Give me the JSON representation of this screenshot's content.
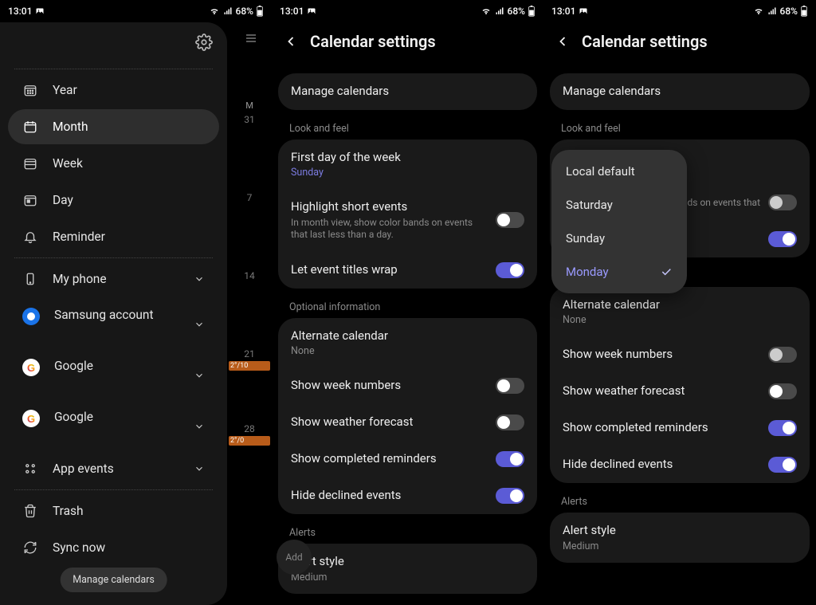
{
  "status": {
    "time": "13:01",
    "battery": "68%"
  },
  "drawer": {
    "items": [
      {
        "icon": "calendar-year-icon",
        "label": "Year"
      },
      {
        "icon": "calendar-month-icon",
        "label": "Month"
      },
      {
        "icon": "calendar-week-icon",
        "label": "Week"
      },
      {
        "icon": "calendar-day-icon",
        "label": "Day"
      },
      {
        "icon": "bell-icon",
        "label": "Reminder"
      }
    ],
    "accounts": [
      {
        "icon": "phone-icon",
        "label": "My phone"
      },
      {
        "icon": "samsung-icon",
        "label": "Samsung account"
      },
      {
        "icon": "google-icon",
        "label": "Google"
      },
      {
        "icon": "google-icon",
        "label": "Google"
      },
      {
        "icon": "apps-icon",
        "label": "App events"
      }
    ],
    "bottom": [
      {
        "icon": "trash-icon",
        "label": "Trash"
      },
      {
        "icon": "sync-icon",
        "label": "Sync now"
      }
    ],
    "manage_chip": "Manage calendars",
    "bg_day_header": "M",
    "bg_days": [
      "31",
      "7",
      "14",
      "21",
      "28"
    ],
    "bg_events": {
      "21": "2°/10",
      "28": "2°/0"
    }
  },
  "settings": {
    "title": "Calendar settings",
    "manage": "Manage calendars",
    "look_label": "Look and feel",
    "first_day": {
      "title": "First day of the week",
      "value": "Sunday"
    },
    "highlight": {
      "title": "Highlight short events",
      "desc": "In month view, show color bands on events that last less than a day."
    },
    "wrap": {
      "title": "Let event titles wrap"
    },
    "optional_label": "Optional information",
    "alt_cal": {
      "title": "Alternate calendar",
      "value": "None"
    },
    "week_num": {
      "title": "Show week numbers"
    },
    "weather": {
      "title": "Show weather forecast"
    },
    "completed": {
      "title": "Show completed reminders"
    },
    "declined": {
      "title": "Hide declined events"
    },
    "alerts_label": "Alerts",
    "alert_style": {
      "title": "Alert style",
      "value": "Medium"
    },
    "add_label": "Add"
  },
  "panel3": {
    "highlight_desc_truncated": "nds on events that",
    "popup": {
      "options": [
        "Local default",
        "Saturday",
        "Sunday",
        "Monday"
      ],
      "selected": "Monday"
    }
  }
}
